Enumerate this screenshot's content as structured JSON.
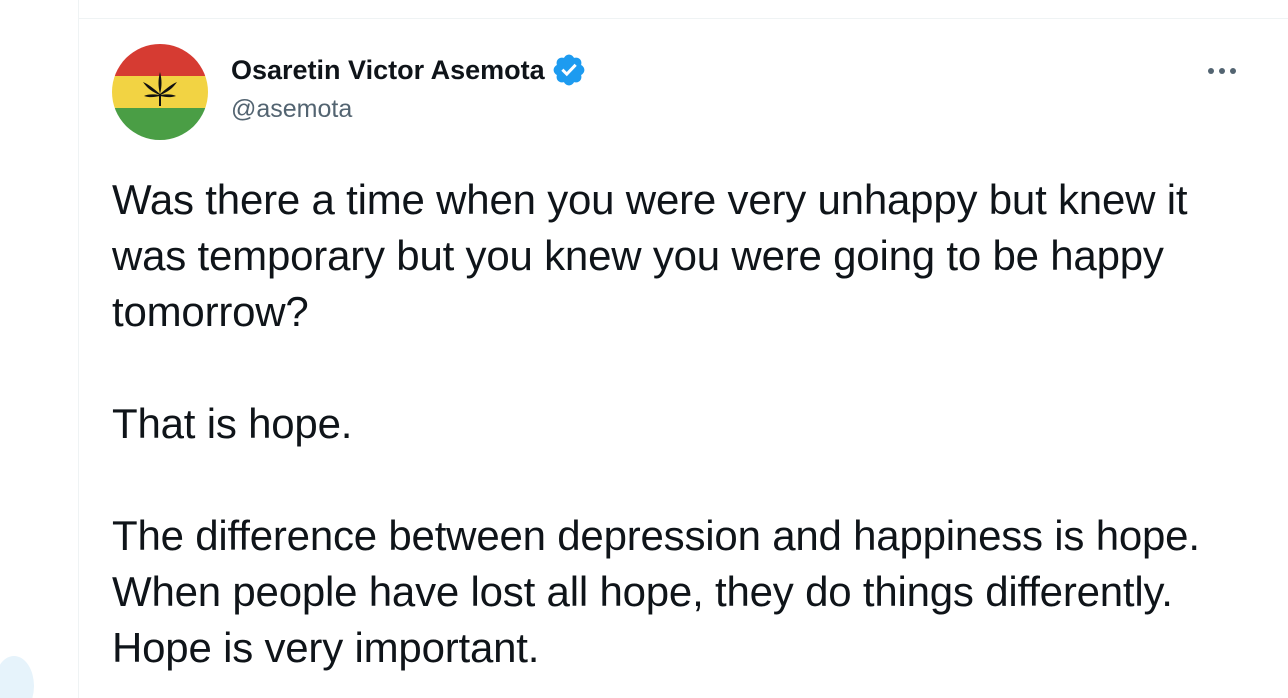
{
  "tweet": {
    "author": {
      "display_name": "Osaretin Victor Asemota",
      "handle": "@asemota",
      "verified": true,
      "verified_icon": "verified-badge-icon",
      "avatar": {
        "icon": "cannabis-leaf-icon",
        "colors": {
          "top": "#d63b32",
          "middle": "#f2d343",
          "bottom": "#4a9e45"
        }
      }
    },
    "more_icon": "more-horizontal-icon",
    "paragraphs": [
      "Was there a time when you were very unhappy but knew it was temporary but you knew you were going to be happy tomorrow?",
      "That is hope.",
      "The difference between depression and happiness is hope. When people have lost all hope, they do things differently. Hope is very important."
    ]
  },
  "colors": {
    "text_primary": "#0f1419",
    "text_secondary": "#536471",
    "accent": "#1d9bf0",
    "divider": "#eff3f4"
  }
}
